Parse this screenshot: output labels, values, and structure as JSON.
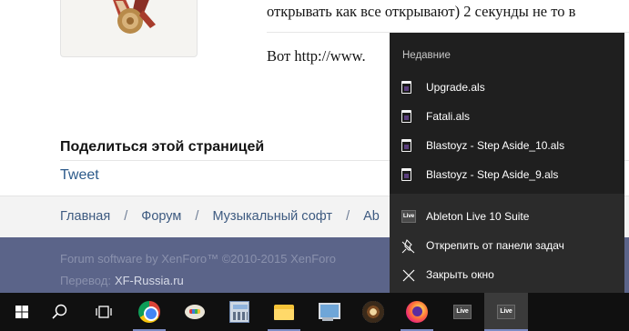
{
  "forum": {
    "post_line_1": "открывать как все открывают) 2 секунды не то в",
    "post_line_2": "Вот http://www.",
    "share_title": "Поделиться этой страницей",
    "tweet": "Tweet",
    "breadcrumbs": [
      "Главная",
      "Форум",
      "Музыкальный софт",
      "Ab"
    ],
    "separator": "/",
    "footer_line_1": "Forum software by XenForo™ ©2010-2015 XenForo",
    "footer_line_2_label": "Перевод:",
    "footer_site": "XF-Russia.ru"
  },
  "jumplist": {
    "header": "Недавние",
    "recent": [
      {
        "label": "Upgrade.als",
        "icon": "als-file-icon"
      },
      {
        "label": "Fatali.als",
        "icon": "als-file-icon"
      },
      {
        "label": "Blastoyz - Step Aside_10.als",
        "icon": "als-file-icon"
      },
      {
        "label": "Blastoyz - Step Aside_9.als",
        "icon": "als-file-icon"
      }
    ],
    "app_name": "Ableton Live 10 Suite",
    "unpin": "Открепить от панели задач",
    "close": "Закрыть окно",
    "live_icon_text": "Live"
  },
  "taskbar": {
    "apps": [
      {
        "name": "start",
        "icon": "windows-logo-icon"
      },
      {
        "name": "search",
        "icon": "search-icon"
      },
      {
        "name": "task-view",
        "icon": "task-view-icon"
      },
      {
        "name": "chrome",
        "icon": "chrome-icon"
      },
      {
        "name": "paint",
        "icon": "paint-icon"
      },
      {
        "name": "calculator",
        "icon": "calculator-icon"
      },
      {
        "name": "file-explorer",
        "icon": "folder-icon"
      },
      {
        "name": "this-pc",
        "icon": "computer-icon"
      },
      {
        "name": "media-player",
        "icon": "music-disc-icon"
      },
      {
        "name": "firefox",
        "icon": "firefox-icon"
      },
      {
        "name": "ableton-live",
        "icon": "ableton-live-icon",
        "text": "Live"
      },
      {
        "name": "ableton-live-active",
        "icon": "ableton-live-icon",
        "text": "Live"
      }
    ]
  },
  "colors": {
    "forum_footer": "#5b6489",
    "link": "#3d5a80",
    "jumplist_bg": "#1f1f1f",
    "taskbar_bg": "#101010",
    "taskbar_accent": "#7d8cc4"
  }
}
